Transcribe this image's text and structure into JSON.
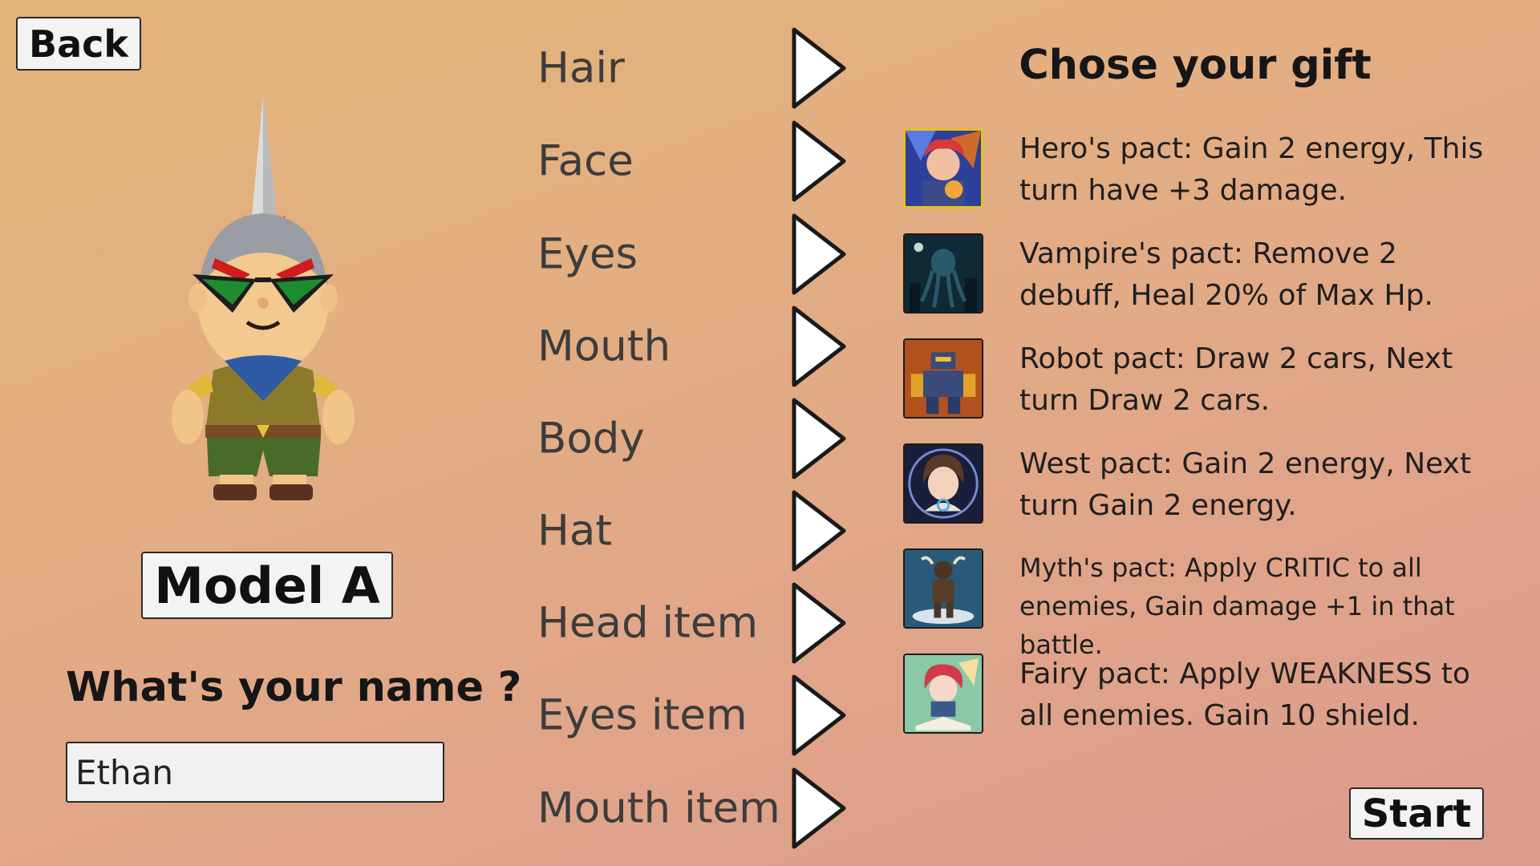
{
  "nav": {
    "back_label": "Back"
  },
  "character": {
    "model_label": "Model A",
    "name_question": "What's your name ?",
    "name_value": "Ethan"
  },
  "customization": {
    "options": [
      {
        "label": "Hair"
      },
      {
        "label": "Face"
      },
      {
        "label": "Eyes"
      },
      {
        "label": "Mouth"
      },
      {
        "label": "Body"
      },
      {
        "label": "Hat"
      },
      {
        "label": "Head item"
      },
      {
        "label": "Eyes item"
      },
      {
        "label": "Mouth item"
      }
    ]
  },
  "gifts": {
    "title": "Chose your gift",
    "items": [
      {
        "text": "Hero's pact:  Gain 2 energy, This turn have +3 damage.",
        "icon": "hero-portrait-icon",
        "frame": "#e6c21a"
      },
      {
        "text": "Vampire's pact: Remove 2 debuff, Heal 20% of Max Hp.",
        "icon": "vampire-octopus-icon",
        "frame": "#1c1c1c"
      },
      {
        "text": "Robot pact: Draw 2 cars, Next turn Draw 2 cars.",
        "icon": "robot-icon",
        "frame": "#1c1c1c"
      },
      {
        "text": "West pact: Gain 2 energy, Next turn Gain 2 energy.",
        "icon": "west-girl-icon",
        "frame": "#1c1c1c"
      },
      {
        "text": "Myth's pact: Apply CRITIC to all enemies, Gain damage +1 in that battle.",
        "icon": "minotaur-icon",
        "frame": "#1c1c1c"
      },
      {
        "text": "Fairy pact: Apply WEAKNESS to all enemies. Gain 10 shield.",
        "icon": "fairy-icon",
        "frame": "#1c1c1c"
      }
    ]
  },
  "start_label": "Start"
}
